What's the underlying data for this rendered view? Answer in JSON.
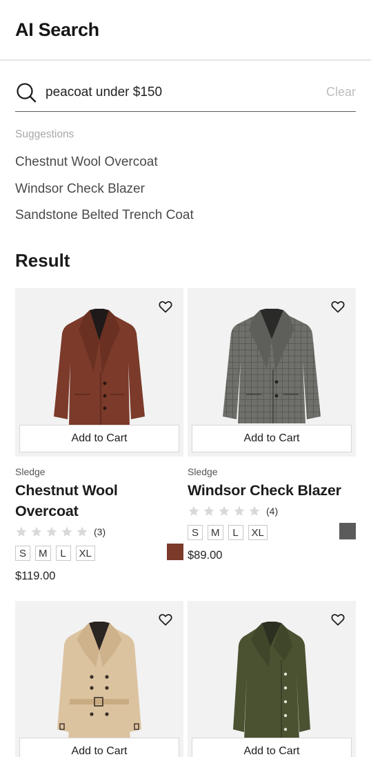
{
  "header": {
    "title": "AI Search"
  },
  "search": {
    "query": "peacoat under $150",
    "clear_label": "Clear"
  },
  "suggestions": {
    "title": "Suggestions",
    "items": [
      "Chestnut Wool Overcoat",
      "Windsor Check Blazer",
      "Sandstone Belted Trench Coat"
    ]
  },
  "result": {
    "title": "Result"
  },
  "colors": {
    "card_bg": "#f2f2f2",
    "star_empty": "#d9d9d9",
    "chestnut": "#7b3a2a",
    "charcoal": "#5b5b5b"
  },
  "products": [
    {
      "brand": "Sledge",
      "name": "Chestnut Wool Overcoat",
      "rating_count": "(3)",
      "stars": 0,
      "sizes": [
        "S",
        "M",
        "L",
        "XL"
      ],
      "swatch_color": "#7b3a2a",
      "price": "$119.00",
      "cart_label": "Add to Cart",
      "icon": "overcoat"
    },
    {
      "brand": "Sledge",
      "name": "Windsor Check Blazer",
      "rating_count": "(4)",
      "stars": 0,
      "sizes": [
        "S",
        "M",
        "L",
        "XL"
      ],
      "swatch_color": "#5b5b5b",
      "price": "$89.00",
      "cart_label": "Add to Cart",
      "icon": "blazer"
    },
    {
      "cart_label": "Add to Cart",
      "icon": "trench-coat"
    },
    {
      "cart_label": "Add to Cart",
      "icon": "military-coat"
    }
  ]
}
